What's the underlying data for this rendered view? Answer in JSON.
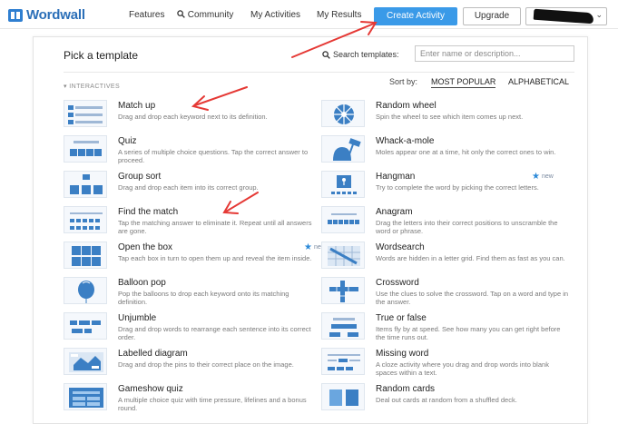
{
  "header": {
    "logo_text": "Wordwall",
    "nav": [
      "Features",
      "Community",
      "My Activities",
      "My Results"
    ],
    "create_label": "Create Activity",
    "upgrade_label": "Upgrade"
  },
  "picker": {
    "title": "Pick a template",
    "search_label": "Search templates:",
    "search_placeholder": "Enter name or description...",
    "section": "INTERACTIVES",
    "sort_label": "Sort by:",
    "sort_popular": "MOST POPULAR",
    "sort_alpha": "ALPHABETICAL",
    "new_label": "new",
    "templates": [
      {
        "name": "Match up",
        "desc": "Drag and drop each keyword next to its definition."
      },
      {
        "name": "Random wheel",
        "desc": "Spin the wheel to see which item comes up next."
      },
      {
        "name": "Quiz",
        "desc": "A series of multiple choice questions. Tap the correct answer to proceed."
      },
      {
        "name": "Whack-a-mole",
        "desc": "Moles appear one at a time, hit only the correct ones to win."
      },
      {
        "name": "Group sort",
        "desc": "Drag and drop each item into its correct group."
      },
      {
        "name": "Hangman",
        "desc": "Try to complete the word by picking the correct letters."
      },
      {
        "name": "Find the match",
        "desc": "Tap the matching answer to eliminate it. Repeat until all answers are gone."
      },
      {
        "name": "Anagram",
        "desc": "Drag the letters into their correct positions to unscramble the word or phrase."
      },
      {
        "name": "Open the box",
        "desc": "Tap each box in turn to open them up and reveal the item inside."
      },
      {
        "name": "Wordsearch",
        "desc": "Words are hidden in a letter grid. Find them as fast as you can."
      },
      {
        "name": "Balloon pop",
        "desc": "Pop the balloons to drop each keyword onto its matching definition."
      },
      {
        "name": "Crossword",
        "desc": "Use the clues to solve the crossword. Tap on a word and type in the answer."
      },
      {
        "name": "Unjumble",
        "desc": "Drag and drop words to rearrange each sentence into its correct order."
      },
      {
        "name": "True or false",
        "desc": "Items fly by at speed. See how many you can get right before the time runs out."
      },
      {
        "name": "Labelled diagram",
        "desc": "Drag and drop the pins to their correct place on the image."
      },
      {
        "name": "Missing word",
        "desc": "A cloze activity where you drag and drop words into blank spaces within a text."
      },
      {
        "name": "Gameshow quiz",
        "desc": "A multiple choice quiz with time pressure, lifelines and a bonus round."
      },
      {
        "name": "Random cards",
        "desc": "Deal out cards at random from a shuffled deck."
      }
    ]
  },
  "colors": {
    "accent": "#3a9ae8",
    "brand": "#2b6fb8",
    "annotation_arrow": "#e53935"
  }
}
